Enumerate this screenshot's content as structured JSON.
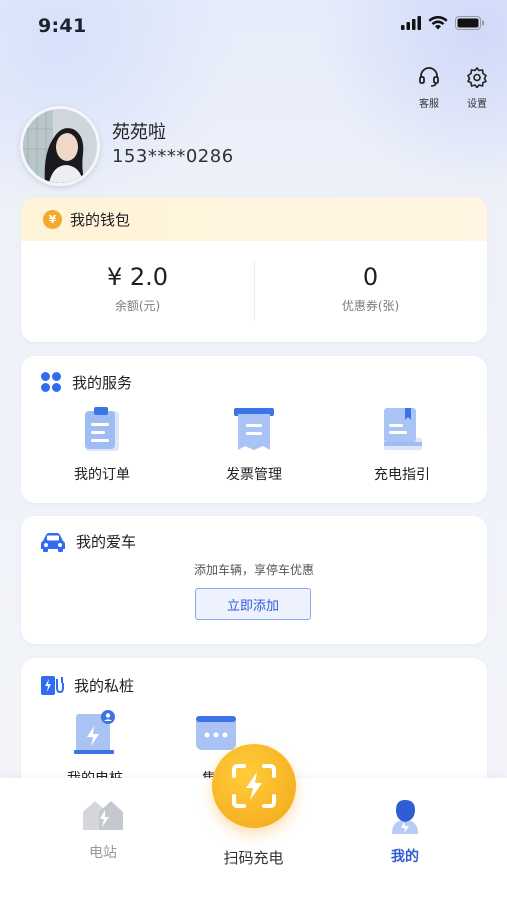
{
  "status_bar": {
    "time": "9:41"
  },
  "top_actions": {
    "service_label": "客服",
    "settings_label": "设置"
  },
  "profile": {
    "name": "苑苑啦",
    "phone": "153****0286"
  },
  "wallet": {
    "title": "我的钱包",
    "coin_symbol": "¥",
    "balance_value": "¥ 2.0",
    "balance_label": "余额(元)",
    "coupon_value": "0",
    "coupon_label": "优惠券(张)"
  },
  "services": {
    "title": "我的服务",
    "items": [
      {
        "label": "我的订单",
        "icon": "order-icon"
      },
      {
        "label": "发票管理",
        "icon": "invoice-icon"
      },
      {
        "label": "充电指引",
        "icon": "guide-icon"
      }
    ]
  },
  "car": {
    "title": "我的爱车",
    "tip": "添加车辆，享停车优惠",
    "add_label": "立即添加"
  },
  "private_pile": {
    "title": "我的私桩",
    "items": [
      {
        "label": "我的电桩",
        "icon": "my-charger-icon"
      },
      {
        "label": "售后",
        "icon": "after-sales-icon"
      }
    ]
  },
  "tabbar": {
    "station_label": "电站",
    "scan_label": "扫码充电",
    "mine_label": "我的"
  },
  "colors": {
    "accent": "#2f5ed2",
    "scan": "#f3a71a",
    "wallet_header": "#fff3d8"
  }
}
